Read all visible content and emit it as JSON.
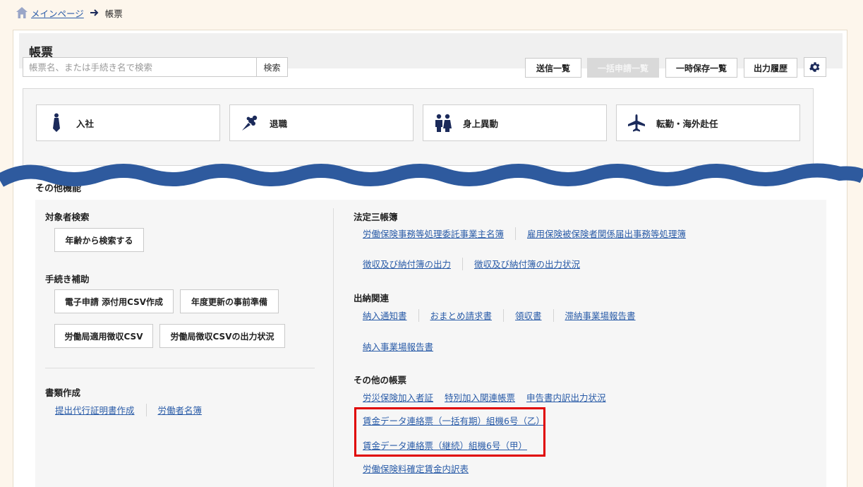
{
  "breadcrumb": {
    "home_label": "メインページ",
    "current": "帳票"
  },
  "page": {
    "title": "帳票"
  },
  "search": {
    "placeholder": "帳票名、または手続き名で検索",
    "button_label": "検索"
  },
  "toolbar": {
    "sent_list": "送信一覧",
    "bulk_list": "一括申請一覧",
    "saved_list": "一時保存一覧",
    "output_history": "出力履歴"
  },
  "categories": [
    {
      "label": "入社",
      "icon": "necktie-icon"
    },
    {
      "label": "退職",
      "icon": "bouquet-icon"
    },
    {
      "label": "身上異動",
      "icon": "couple-icon"
    },
    {
      "label": "転勤・海外赴任",
      "icon": "airplane-icon"
    }
  ],
  "other_label": "その他機能",
  "left": {
    "subject_search": {
      "title": "対象者検索",
      "btn": "年齢から検索する"
    },
    "procedure_help": {
      "title": "手続き補助",
      "btns": [
        "電子申請 添付用CSV作成",
        "年度更新の事前準備",
        "労働局適用徴収CSV",
        "労働局徴収CSVの出力状況"
      ]
    },
    "documents": {
      "title": "書類作成",
      "links": [
        "提出代行証明書作成",
        "労働者名簿"
      ]
    }
  },
  "right": {
    "legal": {
      "title": "法定三帳簿",
      "links": [
        "労働保険事務等処理委託事業主名簿",
        "雇用保険被保険者関係届出事務等処理簿",
        "徴収及び納付簿の出力",
        "徴収及び納付簿の出力状況"
      ]
    },
    "payments": {
      "title": "出納関連",
      "links": [
        "納入通知書",
        "おまとめ請求書",
        "領収書",
        "滞納事業場報告書",
        "納入事業場報告書"
      ]
    },
    "others": {
      "title": "その他の帳票",
      "links": [
        "労災保険加入者証",
        "特別加入関連帳票",
        "申告書内訳出力状況",
        "賃金データ連絡票（一括有期）組機6号（乙）",
        "賃金データ連絡票（継続）組機6号（甲）",
        "労働保険料確定賃金内訳表"
      ]
    }
  },
  "colors": {
    "accent_link": "#2a5ca8",
    "wave": "#2e5a9e",
    "highlight": "#e00000",
    "icon_navy": "#1b2a5a"
  }
}
